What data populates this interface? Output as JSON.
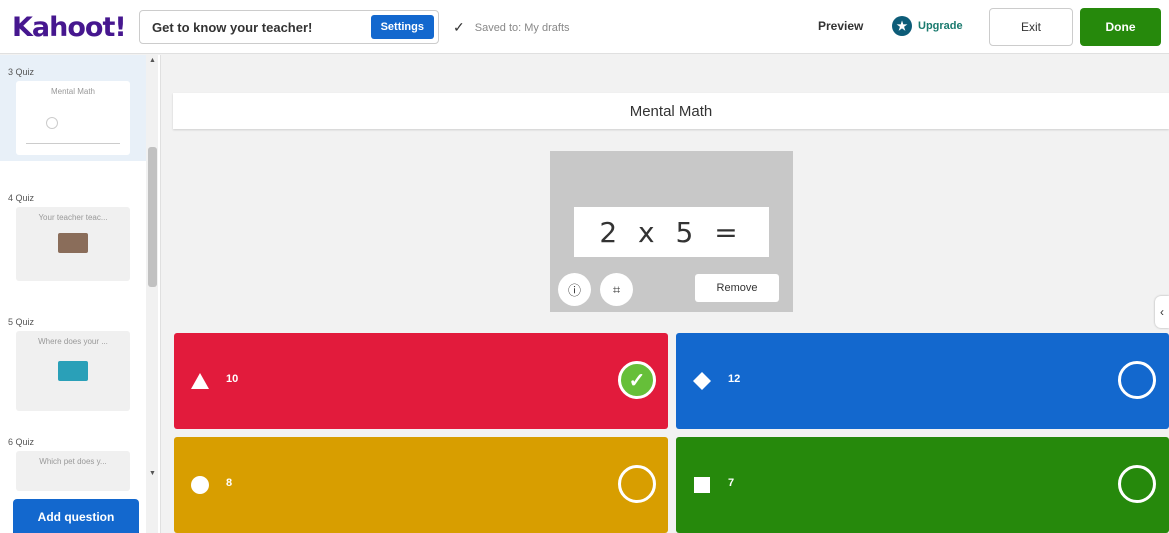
{
  "app": {
    "logo": "Kahoot!"
  },
  "header": {
    "quiz_title": "Get to know your teacher!",
    "settings_label": "Settings",
    "saved_text": "Saved to: My drafts",
    "preview_label": "Preview",
    "upgrade_label": "Upgrade",
    "exit_label": "Exit",
    "done_label": "Done"
  },
  "sidebar": {
    "slides": [
      {
        "label": "3  Quiz",
        "question": "Mental Math"
      },
      {
        "label": "4  Quiz",
        "question": "Your teacher teac..."
      },
      {
        "label": "5  Quiz",
        "question": "Where does your ..."
      },
      {
        "label": "6  Quiz",
        "question": "Which pet does y..."
      }
    ],
    "add_question_label": "Add question"
  },
  "question": {
    "title": "Mental Math",
    "media_text": "2 x 5 =",
    "remove_label": "Remove"
  },
  "answers": [
    {
      "text": "10",
      "color": "#e21b3c",
      "shape": "triangle",
      "correct": true
    },
    {
      "text": "12",
      "color": "#1368ce",
      "shape": "diamond",
      "correct": false
    },
    {
      "text": "8",
      "color": "#d89e00",
      "shape": "circle",
      "correct": false
    },
    {
      "text": "7",
      "color": "#26890c",
      "shape": "square",
      "correct": false
    }
  ]
}
